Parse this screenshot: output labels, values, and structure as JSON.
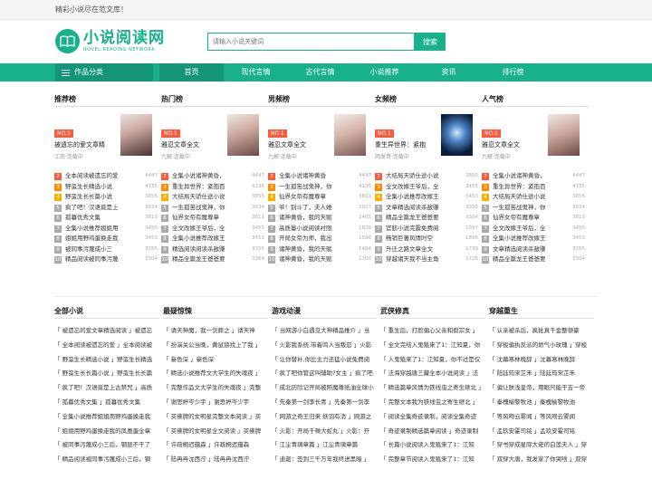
{
  "topbar": {
    "text": "精彩小说尽在范文库！"
  },
  "logo": {
    "title": "小说阅读网",
    "subtitle": "NOVEL READING NETWORK"
  },
  "search": {
    "placeholder": "请输入小说关键词",
    "button": "搜索"
  },
  "nav": {
    "category": "作品分类",
    "items": [
      "首页",
      "现代言情",
      "古代言情",
      "小说推荐",
      "资讯",
      "排行榜"
    ]
  },
  "rankings": [
    {
      "title": "推荐榜",
      "feat_badge": "NO.1",
      "feat_title": "被遗忘的爱文章精",
      "feat_meta": "江南·连载中",
      "has_cover": true,
      "items": [
        {
          "name": "全本阅读被遗忘的爱",
          "count": "4447"
        },
        {
          "name": "野蛮生长精选小说",
          "count": "4135"
        },
        {
          "name": "野蛮生长长篇小说",
          "count": "3855"
        },
        {
          "name": "疯了吧！汉语竟是上",
          "count": "3834"
        },
        {
          "name": "孤暮优秀文集",
          "count": "3811"
        },
        {
          "name": "全集小说推荐姐姐用",
          "count": "3455"
        },
        {
          "name": "姐姐用野鸡蛋换走我",
          "count": "3453"
        },
        {
          "name": "被同事污蔑成小三",
          "count": "3355"
        },
        {
          "name": "精品阅读被同事污蔑",
          "count": "3304"
        }
      ]
    },
    {
      "title": "热门榜",
      "feat_badge": "NO.1",
      "feat_title": "雅忍文章全文",
      "feat_meta": "九解·连载中",
      "has_cover": true,
      "items": [
        {
          "name": "全集小说诸神黄昏，",
          "count": "4447"
        },
        {
          "name": "重生异世界：紧抱百",
          "count": "4135"
        },
        {
          "name": "大结局天骄仕途小说",
          "count": "3855"
        },
        {
          "name": "一生孤苦战鬼神，你",
          "count": "3834"
        },
        {
          "name": "仙界女帝有魔尊章",
          "count": "3811"
        },
        {
          "name": "全文改嫁王爷后，全",
          "count": "3455"
        },
        {
          "name": "全集小说推荐改嫁王",
          "count": "3453"
        },
        {
          "name": "精选阅读阅读杀敌赚",
          "count": "3355"
        },
        {
          "name": "精品全篇龙王爸爸要",
          "count": "3304"
        }
      ]
    },
    {
      "title": "男频榜",
      "feat_badge": "NO.1",
      "feat_title": "雅忍文章全文",
      "feat_meta": "九解·连载中",
      "has_cover": true,
      "items": [
        {
          "name": "全集小说诸神黄昏",
          "count": "4447"
        },
        {
          "name": "一生孤苦战鬼神，你",
          "count": "4135"
        },
        {
          "name": "仙界女帝有魔尊章",
          "count": "3811"
        },
        {
          "name": "爷！别斗了，夫人她",
          "count": "2927"
        },
        {
          "name": "诸神黄昏，我的天赋",
          "count": "2405"
        },
        {
          "name": "高质量小说阅读衬限",
          "count": "1829"
        },
        {
          "name": "开局女帝为师，我出",
          "count": "1596"
        },
        {
          "name": "诸神黄昏，我的天赋",
          "count": "1464"
        },
        {
          "name": "诸神黄昏，我的天赋",
          "count": "1300"
        }
      ]
    },
    {
      "title": "女频榜",
      "feat_badge": "NO.1",
      "feat_title": "重生异世界：紧抱",
      "feat_meta": "网发哥·连载中",
      "has_cover": true,
      "items": [
        {
          "name": "大结局天骄仕途小说",
          "count": "3855"
        },
        {
          "name": "全文改嫁王爷后，全",
          "count": "3455"
        },
        {
          "name": "全集小说推荐改嫁王",
          "count": "3453"
        },
        {
          "name": "文章精选阅读杀敌赚",
          "count": "3355"
        },
        {
          "name": "精品全篇龙王爸爸要",
          "count": "3304"
        },
        {
          "name": "官舫小说完震免费阅",
          "count": "1997"
        },
        {
          "name": "畅销巨著风情时空",
          "count": "1896"
        },
        {
          "name": "升迁之路文章全文",
          "count": "1739"
        },
        {
          "name": "穿越诸天我不当主角",
          "count": "1726"
        }
      ]
    },
    {
      "title": "人气榜",
      "feat_badge": "NO.1",
      "feat_title": "雅忍文章全文",
      "feat_meta": "九解·连载中",
      "has_cover": true,
      "items": [
        {
          "name": "全集小说诸神黄昏，",
          "count": "4447"
        },
        {
          "name": "重生异世界：紧抱百",
          "count": "4135"
        },
        {
          "name": "大结局天骄仕途小说",
          "count": "3855"
        },
        {
          "name": "一生孤苦战鬼神，你",
          "count": "3834"
        },
        {
          "name": "仙界女帝有魔尊章",
          "count": "3811"
        },
        {
          "name": "全文改嫁王爷后，全",
          "count": "3455"
        },
        {
          "name": "全集小说推荐改嫁王",
          "count": "3453"
        },
        {
          "name": "文章精选阅读杀敌赚",
          "count": "3355"
        },
        {
          "name": "精品全篇龙王爸爸要",
          "count": "3304"
        }
      ]
    }
  ],
  "categories": [
    {
      "title": "全部小说",
      "items": [
        "「 被遗忘的爱文章精选阅读 」被遗忘",
        "「 全本阅读被遗忘的爱 」全本阅读被",
        "「 野蛮生长精选小说 」野蛮生长精选",
        "「 野蛮生长长篇小说 」野蛮生长长篇",
        "「 疯了吧！汉语竟是上古禁咒 」高质",
        "「 孤暮优秀文集 」孤暮优秀文集",
        "「 全集小说推荐姐姐用野鸡蛋换走我",
        "「 姐姐用野鸡蛋换走我的凤凰蛋全章",
        "「 被同事污蔑成小三后，钢琵不干了",
        "「 精品阅读被同事污蔑成小三后，钢"
      ]
    },
    {
      "title": "最疑惊悚",
      "items": [
        "「 请天神魔，我一剑葬之 」请天神",
        "「 扮演关公当晚，黄鼠狼找上了我 」",
        "「 妾色深 」妾色深",
        "「 精选小说推荐文大学生的失魂夜 」",
        "「 完整作品文大学生的失魂夜 」完整",
        "「 谢思婷岑少宇 」谢思婷岑少宇",
        "「 买佛牌的女明星完整文本阅读 」买",
        "「 买佛牌的女明星全文阅读 」买佛牌",
        "「 许疏桐迟蕴森 」许疏桐迟蕴森",
        "「 陆冉冉沈西泞 」陆冉冉沈西泞"
      ]
    },
    {
      "title": "游戏动漫",
      "items": [
        "「 当网游小白遇见大神精品推介 」当",
        "「 火影我系统,带着鸣人当叛忍 」火影",
        "「 让你替补,你比主力还猛小说免费阅",
        "「 疯了吧你管这叫辅助?女主 」疯了吧",
        "「 成北历险记开局被照魔尊纸油全球小",
        "「 先秦第一剑李长青 」先秦第一剑李",
        "「 网游之奇王归来 妖羽有消 」网游之",
        "「 火影：开局千禅大蛇丸 」火影：开",
        "「 江尘青璃章篇 」江尘青璃章篇",
        "「 迪迦：签到三千万年我终进黑暗 」"
      ]
    },
    {
      "title": "武侠修真",
      "items": [
        "「 重生后，打脸偏心父亲和假宗女 」",
        "「 全文完结入鬼殖来了1：江知夏，你",
        "「 入鬼殖来了1：江知夏，你不过是仅",
        "「 法海穿越唐三藏全本小说阅读 」法",
        "「 精选篇章风情为铁线虫之寄生继北 」",
        "「 完整文本我为铁线虫之寄生继北 」",
        "「 阅读全集奇迹录制，阅读全集奇迹",
        "「 奇迹录制精选篇章阅读 」奇迹录制",
        "「 长篇小说阅读入鬼殖来了1：江知",
        "「 完整章节阅读入鬼殖来了1：江知"
      ]
    },
    {
      "title": "穿越重生",
      "items": [
        "「 认亲被杀后，疯批真千金整顿豪",
        "「 穿梭偏执反派的娇气小玫瑰 」穿梭",
        "「 沈幕寒林晚辞 」沈幕寒林晚辞",
        "「 陆廷筠宋芷禾 」陆廷筠宋芷禾",
        "「 偏让肤浅皇帝，用眼尺能干吉一帝",
        "「 秦槐榆黎牧池 」秦槐榆黎牧池",
        "「 等风吻云雾闻 」等风吻云雾闻",
        "「 孟玖安霍司铭 」孟玖安霍司铭",
        "「 穿书穿成星际大佬的白莲夫人 」穿",
        "「 双穿大唐，我发家了你哭啥 」双穿"
      ]
    }
  ]
}
